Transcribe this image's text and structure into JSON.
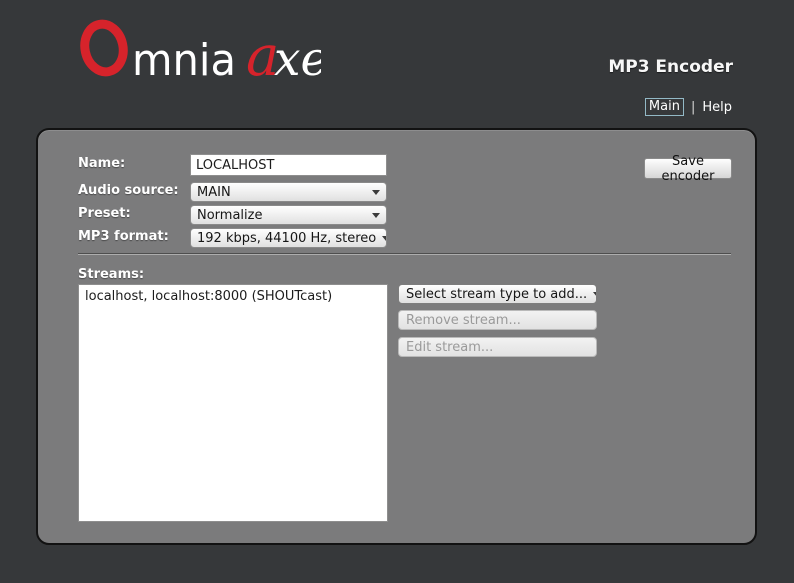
{
  "header": {
    "logo": {
      "brand_o": "O",
      "brand_rest": "mnia",
      "product_a": "a",
      "product_rest": "xe"
    },
    "title": "MP3 Encoder",
    "nav": {
      "main": "Main",
      "separator": "|",
      "help": "Help"
    }
  },
  "encoder_form": {
    "name": {
      "label": "Name:",
      "value": "LOCALHOST"
    },
    "audio_source": {
      "label": "Audio source:",
      "value": "MAIN"
    },
    "preset": {
      "label": "Preset:",
      "value": "Normalize"
    },
    "mp3_format": {
      "label": "MP3 format:",
      "value": "192 kbps, 44100 Hz, stereo"
    },
    "save_button_label": "Save encoder"
  },
  "streams": {
    "label": "Streams:",
    "items": [
      "localhost, localhost:8000 (SHOUTcast)"
    ],
    "add_stream_dropdown_label": "Select stream type to add...",
    "remove_button_label": "Remove stream...",
    "edit_button_label": "Edit stream..."
  },
  "colors": {
    "background": "#36383a",
    "panel": "#7b7b7c",
    "logo_red": "#d6232b",
    "main_link_border": "#93b9c6"
  }
}
